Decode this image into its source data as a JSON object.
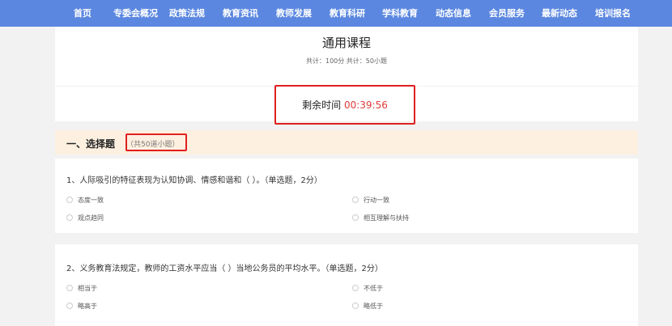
{
  "nav": {
    "items": [
      "首页",
      "专委会概况",
      "政策法规",
      "教育资讯",
      "教师发展",
      "教育科研",
      "学科教育",
      "动态信息",
      "会员服务",
      "最新动态",
      "培训报名"
    ]
  },
  "course": {
    "title": "通用课程",
    "subtitle": "共计：100分 共计：50小题"
  },
  "timer": {
    "label": "剩余时间",
    "value": "00:39:56"
  },
  "section": {
    "title": "一、选择题",
    "count": "（共50道小题）"
  },
  "questions": [
    {
      "text": "1、人际吸引的特征表现为认知协调、情感和谐和（ ）。（单选题，2分）",
      "options": [
        "态度一致",
        "行动一致",
        "观点趋同",
        "相互理解与扶持"
      ]
    },
    {
      "text": "2、义务教育法规定，教师的工资水平应当（ ）当地公务员的平均水平。（单选题，2分）",
      "options": [
        "相当于",
        "不低于",
        "略高于",
        "略低于"
      ]
    }
  ],
  "colors": {
    "nav_bg": "#5b87e0",
    "timer_value": "#e03b3b",
    "highlight_border": "#e02020",
    "section_bg": "#fdf0e0"
  }
}
